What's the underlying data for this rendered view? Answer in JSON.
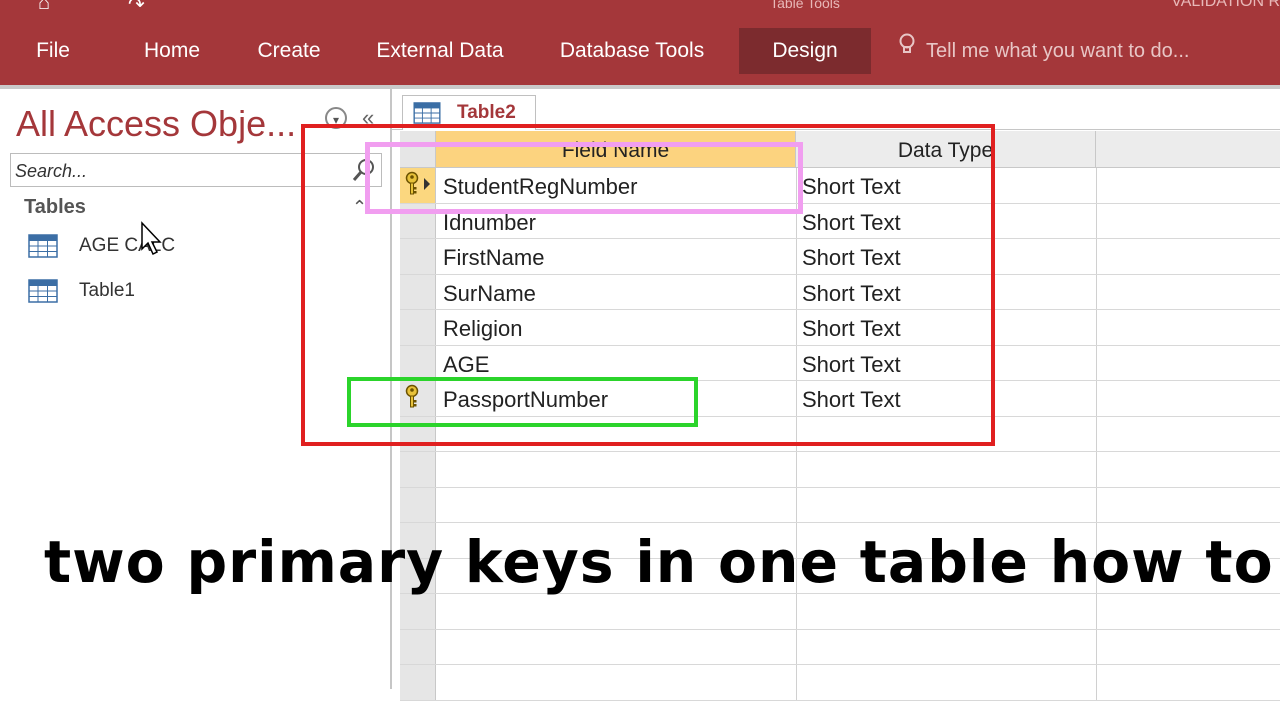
{
  "window": {
    "context_tab_group": "Table Tools",
    "title_fragment": "VALIDATION R"
  },
  "ribbon": {
    "tabs": [
      {
        "label": "File"
      },
      {
        "label": "Home"
      },
      {
        "label": "Create"
      },
      {
        "label": "External Data"
      },
      {
        "label": "Database Tools"
      },
      {
        "label": "Design",
        "active": true
      }
    ],
    "tellme": "Tell me what you want to do..."
  },
  "nav_pane": {
    "title": "All Access Obje...",
    "search_placeholder": "Search...",
    "group": "Tables",
    "items": [
      {
        "label": "AGE CALC"
      },
      {
        "label": "Table1"
      }
    ]
  },
  "document": {
    "tab_label": "Table2",
    "columns": {
      "field_name": "Field Name",
      "data_type": "Data Type"
    },
    "rows": [
      {
        "field": "StudentRegNumber",
        "type": "Short Text",
        "key": true,
        "current": true
      },
      {
        "field": "Idnumber",
        "type": "Short Text",
        "key": false
      },
      {
        "field": "FirstName",
        "type": "Short Text",
        "key": false
      },
      {
        "field": "SurName",
        "type": "Short Text",
        "key": false
      },
      {
        "field": "Religion",
        "type": "Short Text",
        "key": false
      },
      {
        "field": "AGE",
        "type": "Short Text",
        "key": false
      },
      {
        "field": "PassportNumber",
        "type": "Short Text",
        "key": true
      }
    ]
  },
  "overlay": {
    "caption": "two primary keys in one table how to",
    "colors": {
      "red_box": "#e02020",
      "pink_box": "#f19ef0",
      "green_box": "#2bd42b"
    }
  },
  "theme": {
    "accent": "#a4373a",
    "header_highlight": "#fcd37f"
  }
}
